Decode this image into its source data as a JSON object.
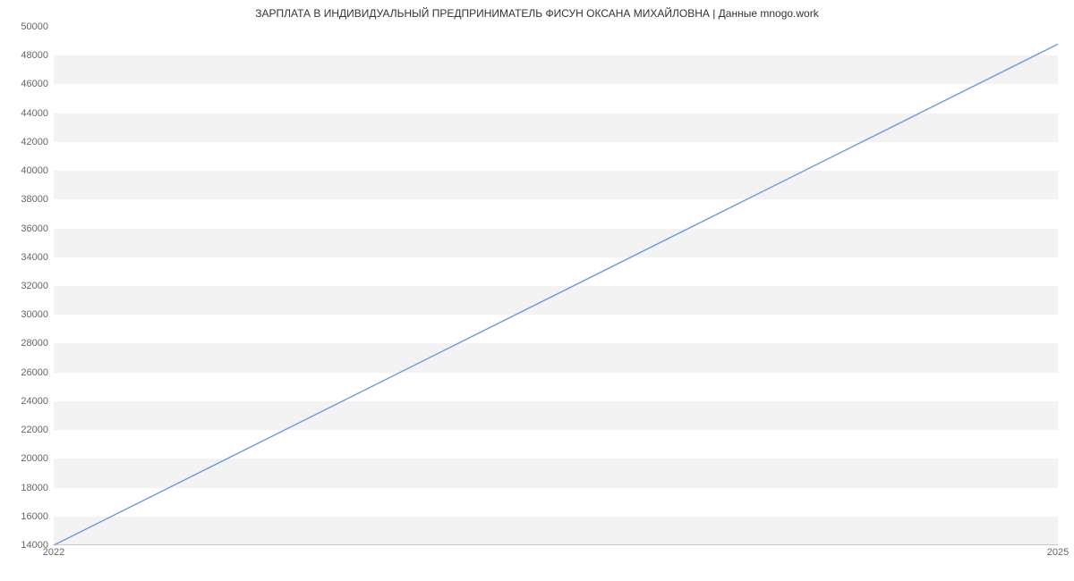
{
  "title": "ЗАРПЛАТА В ИНДИВИДУАЛЬНЫЙ ПРЕДПРИНИМАТЕЛЬ ФИСУН ОКСАНА МИХАЙЛОВНА | Данные mnogo.work",
  "chart_data": {
    "type": "line",
    "x": [
      2022,
      2025
    ],
    "values": [
      14000,
      48800
    ],
    "xlabel": "",
    "ylabel": "",
    "xlim": [
      2022,
      2025
    ],
    "ylim": [
      14000,
      50000
    ],
    "yticks": [
      14000,
      16000,
      18000,
      20000,
      22000,
      24000,
      26000,
      28000,
      30000,
      32000,
      34000,
      36000,
      38000,
      40000,
      42000,
      44000,
      46000,
      48000,
      50000
    ],
    "xticks": [
      2022,
      2025
    ],
    "grid": "bands",
    "series_color": "#6a9bd8",
    "band_color": "#f3f3f3"
  }
}
